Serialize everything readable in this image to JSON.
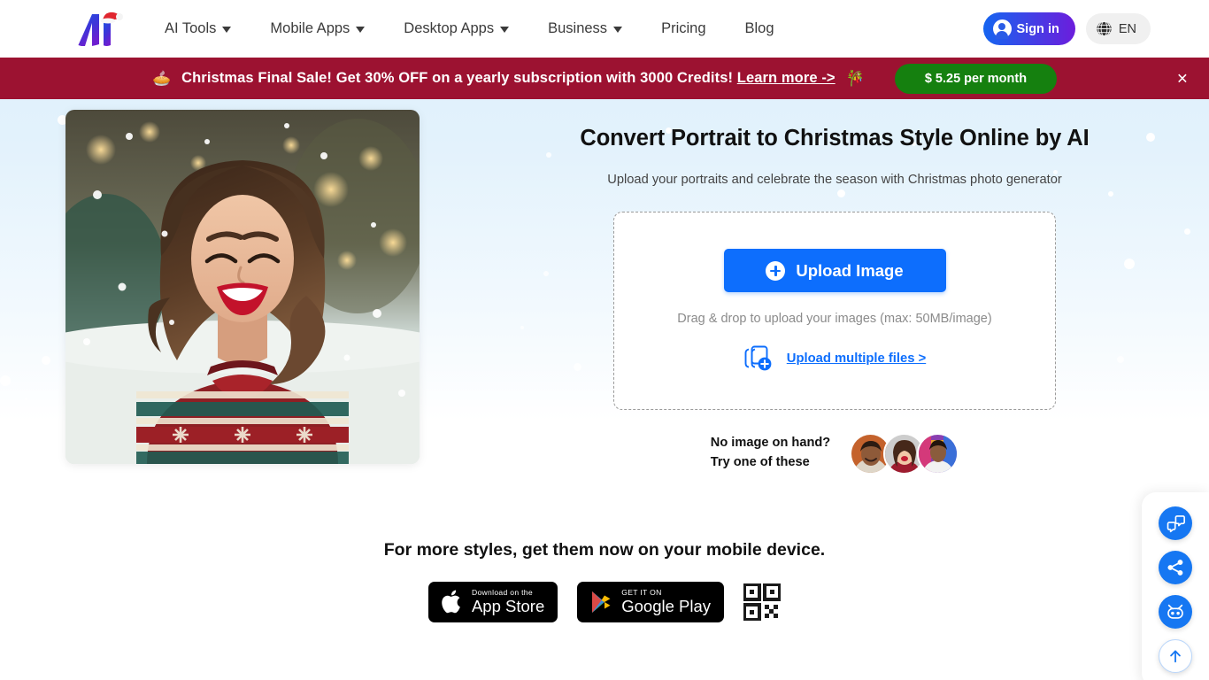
{
  "navbar": {
    "logo_alt": "Ai logo with santa hat",
    "links": [
      {
        "label": "AI Tools",
        "has_caret": true
      },
      {
        "label": "Mobile Apps",
        "has_caret": true
      },
      {
        "label": "Desktop Apps",
        "has_caret": true
      },
      {
        "label": "Business",
        "has_caret": true
      },
      {
        "label": "Pricing",
        "has_caret": false
      },
      {
        "label": "Blog",
        "has_caret": false
      }
    ],
    "signin_label": "Sign in",
    "language_label": "EN",
    "signin_gradient_from": "#1565f0",
    "signin_gradient_to": "#6c1ddc"
  },
  "promo": {
    "left_emoji": "🥧",
    "text_before_link": "Christmas Final Sale! Get 30% OFF on a yearly subscription with 3000 Credits!",
    "link_label": "Learn more ->",
    "right_emoji": "🎋",
    "price_label": "$ 5.25 per month",
    "close_label": "×",
    "bg_color": "#9c1231",
    "price_bg_color": "#15800f"
  },
  "hero": {
    "title": "Convert Portrait to Christmas Style Online by AI",
    "subtitle": "Upload your portraits and celebrate the season with Christmas photo generator",
    "image_alt": "Smiling woman in a red and green Christmas sweater in the snow"
  },
  "upload": {
    "button_label": "Upload Image",
    "drag_text": "Drag & drop to upload your images (max: 50MB/image)",
    "multi_link_label": "Upload multiple files >",
    "button_color": "#0d6efd"
  },
  "samples": {
    "line1": "No image on hand?",
    "line2": "Try one of these",
    "thumbs": [
      {
        "alt": "man smiling on orange background"
      },
      {
        "alt": "woman in red sweater smiling"
      },
      {
        "alt": "woman in white hoodie on colorful mural"
      }
    ]
  },
  "mobile": {
    "title": "For more styles, get them now on your mobile device.",
    "app_store": {
      "small": "Download on the",
      "big": "App Store"
    },
    "google_play": {
      "small": "GET IT ON",
      "big": "Google Play"
    },
    "qr_alt": "QR code to download the app"
  },
  "dock": {
    "buttons": [
      {
        "name": "feedback-chat-icon",
        "label": "Feedback"
      },
      {
        "name": "share-icon",
        "label": "Share"
      },
      {
        "name": "ai-bot-icon",
        "label": "AI Assistant"
      },
      {
        "name": "scroll-to-top-icon",
        "label": "Back to top"
      }
    ],
    "accent_color": "#1677f2"
  }
}
